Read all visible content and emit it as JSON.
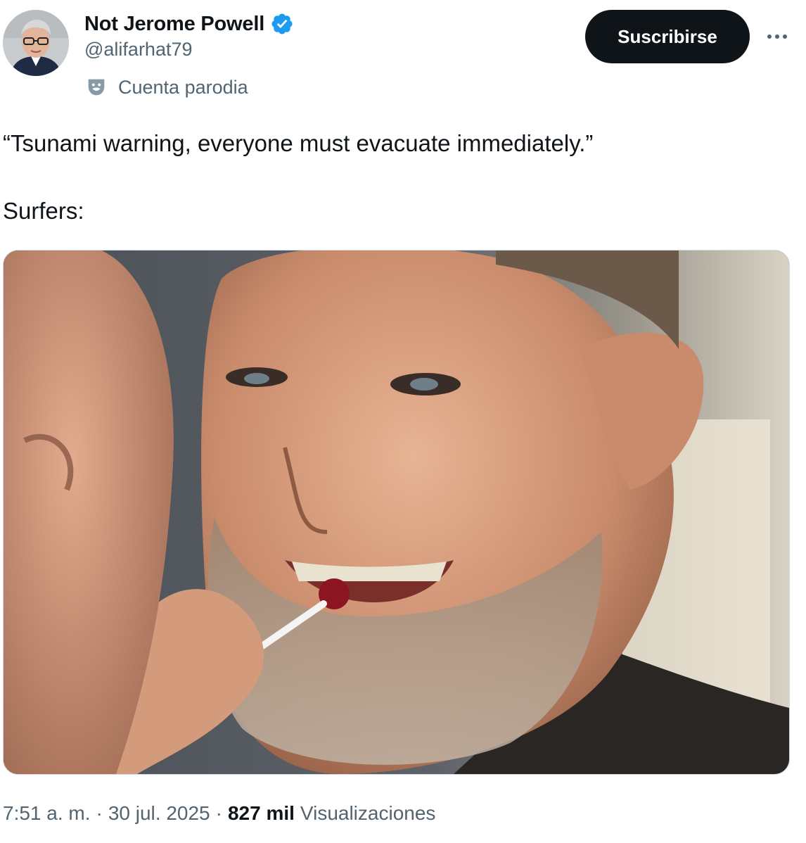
{
  "author": {
    "display_name": "Not Jerome Powell",
    "handle": "@alifarhat79",
    "verified_icon": "verified-badge-icon",
    "badge_color": "#1d9bf0",
    "parody_label": "Cuenta parodia",
    "parody_icon": "theater-mask-icon"
  },
  "actions": {
    "subscribe_label": "Suscribirse",
    "more_icon": "more-horizontal-icon"
  },
  "tweet": {
    "line1": "“Tsunami warning, everyone must evacuate immediately.”",
    "line2": "Surfers:"
  },
  "meta": {
    "time": "7:51 a. m.",
    "separator1": "·",
    "date": "30 jul. 2025",
    "separator2": "·",
    "views_count": "827 mil",
    "views_label": "Visualizaciones"
  },
  "colors": {
    "text_primary": "#0f1419",
    "text_secondary": "#536471",
    "button_bg": "#0f1419",
    "button_text": "#ffffff"
  }
}
